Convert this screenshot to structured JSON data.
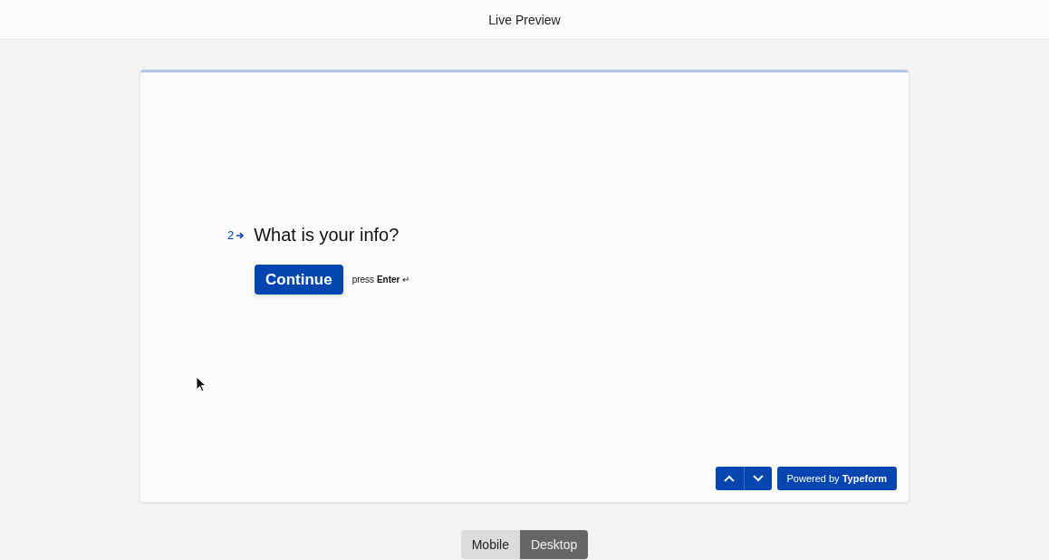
{
  "header": {
    "title": "Live Preview"
  },
  "question": {
    "number": "2",
    "text": "What is your info?"
  },
  "continue_button": {
    "label": "Continue"
  },
  "hint": "press **Enter** ↵",
  "powered_by": "Powered by **Typeform**",
  "view_toggle": [
    {
      "label": "Mobile",
      "selected": false
    },
    {
      "label": "Desktop",
      "selected": true
    }
  ]
}
